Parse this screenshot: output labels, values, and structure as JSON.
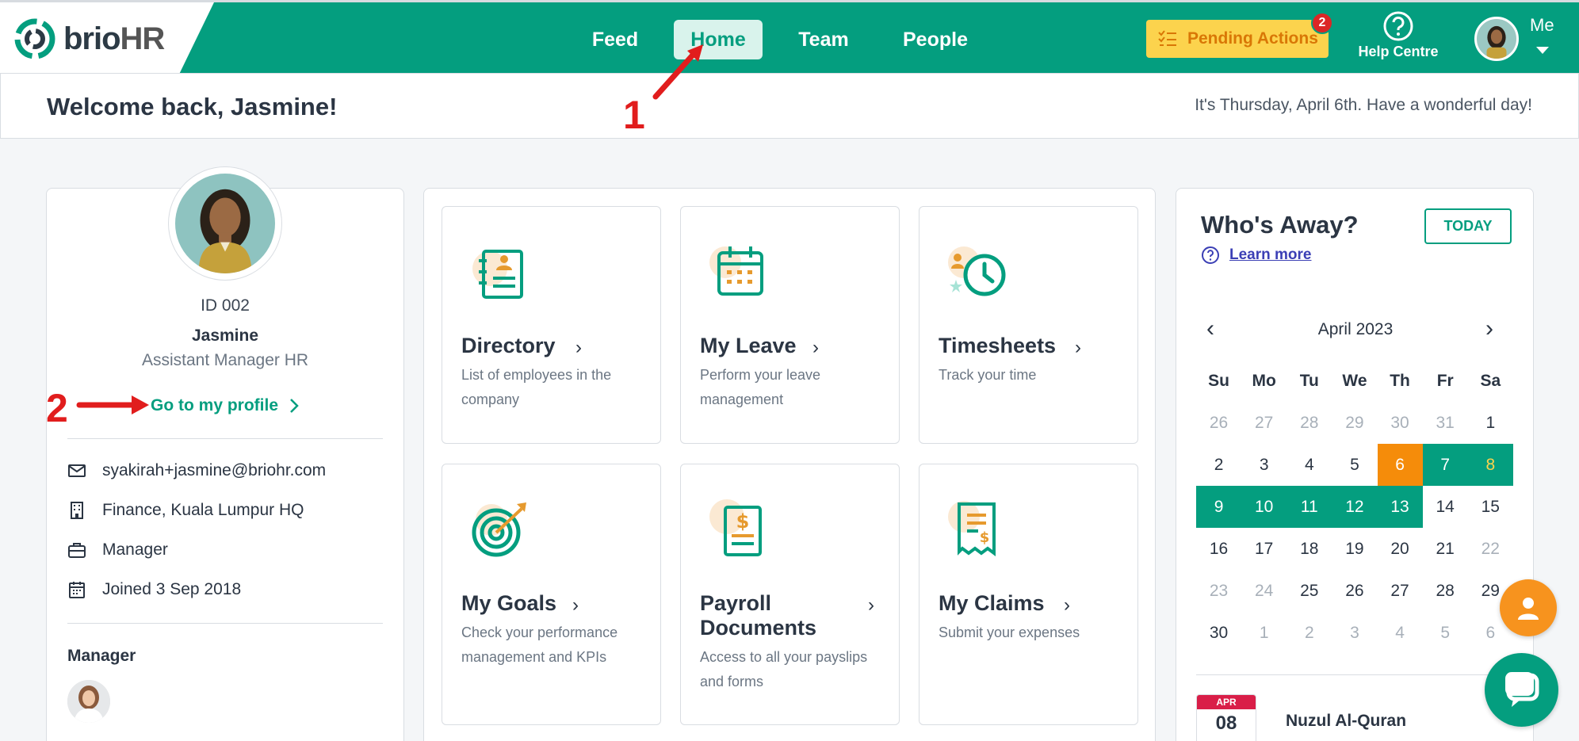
{
  "header": {
    "logo_brio": "brio",
    "logo_hr": "HR",
    "nav": [
      "Feed",
      "Home",
      "Team",
      "People"
    ],
    "pending_label": "Pending Actions",
    "pending_count": "2",
    "help_label": "Help Centre",
    "me_label": "Me"
  },
  "welcome": {
    "title": "Welcome back, Jasmine!",
    "date_text": "It's Thursday, April 6th. Have a wonderful day!"
  },
  "annotations": {
    "one": "1",
    "two": "2",
    "color": "#e11d1d"
  },
  "profile": {
    "id": "ID 002",
    "name": "Jasmine",
    "role": "Assistant Manager HR",
    "link": "Go to my profile",
    "email": "syakirah+jasmine@briohr.com",
    "department": "Finance, Kuala Lumpur HQ",
    "position": "Manager",
    "joined": "Joined 3 Sep 2018",
    "manager_title": "Manager"
  },
  "tiles": [
    {
      "title": "Directory",
      "desc": "List of employees in the company",
      "icon": "directory-icon"
    },
    {
      "title": "My Leave",
      "desc": "Perform your leave management",
      "icon": "calendar-icon"
    },
    {
      "title": "Timesheets",
      "desc": "Track your time",
      "icon": "clock-icon"
    },
    {
      "title": "My Goals",
      "desc": "Check your performance management and KPIs",
      "icon": "target-icon"
    },
    {
      "title": "Payroll Documents",
      "desc": "Access to all your payslips and forms",
      "icon": "payroll-icon"
    },
    {
      "title": "My Claims",
      "desc": "Submit your expenses",
      "icon": "receipt-icon"
    }
  ],
  "away": {
    "title": "Who's Away?",
    "today_btn": "TODAY",
    "learn_more": "Learn more",
    "month": "April 2023",
    "weekdays": [
      "Su",
      "Mo",
      "Tu",
      "We",
      "Th",
      "Fr",
      "Sa"
    ],
    "weeks": [
      [
        "26",
        "27",
        "28",
        "29",
        "30",
        "31",
        "1"
      ],
      [
        "2",
        "3",
        "4",
        "5",
        "6",
        "7",
        "8"
      ],
      [
        "9",
        "10",
        "11",
        "12",
        "13",
        "14",
        "15"
      ],
      [
        "16",
        "17",
        "18",
        "19",
        "20",
        "21",
        "22"
      ],
      [
        "23",
        "24",
        "25",
        "26",
        "27",
        "28",
        "29"
      ],
      [
        "30",
        "1",
        "2",
        "3",
        "4",
        "5",
        "6"
      ]
    ],
    "holiday_month": "APR",
    "holiday_day": "08",
    "holiday_name": "Nuzul Al-Quran"
  },
  "colors": {
    "brand": "#049e7f",
    "pending_bg": "#fcd34d",
    "today": "#f58c0a",
    "accent_orange": "#e69a2e"
  }
}
